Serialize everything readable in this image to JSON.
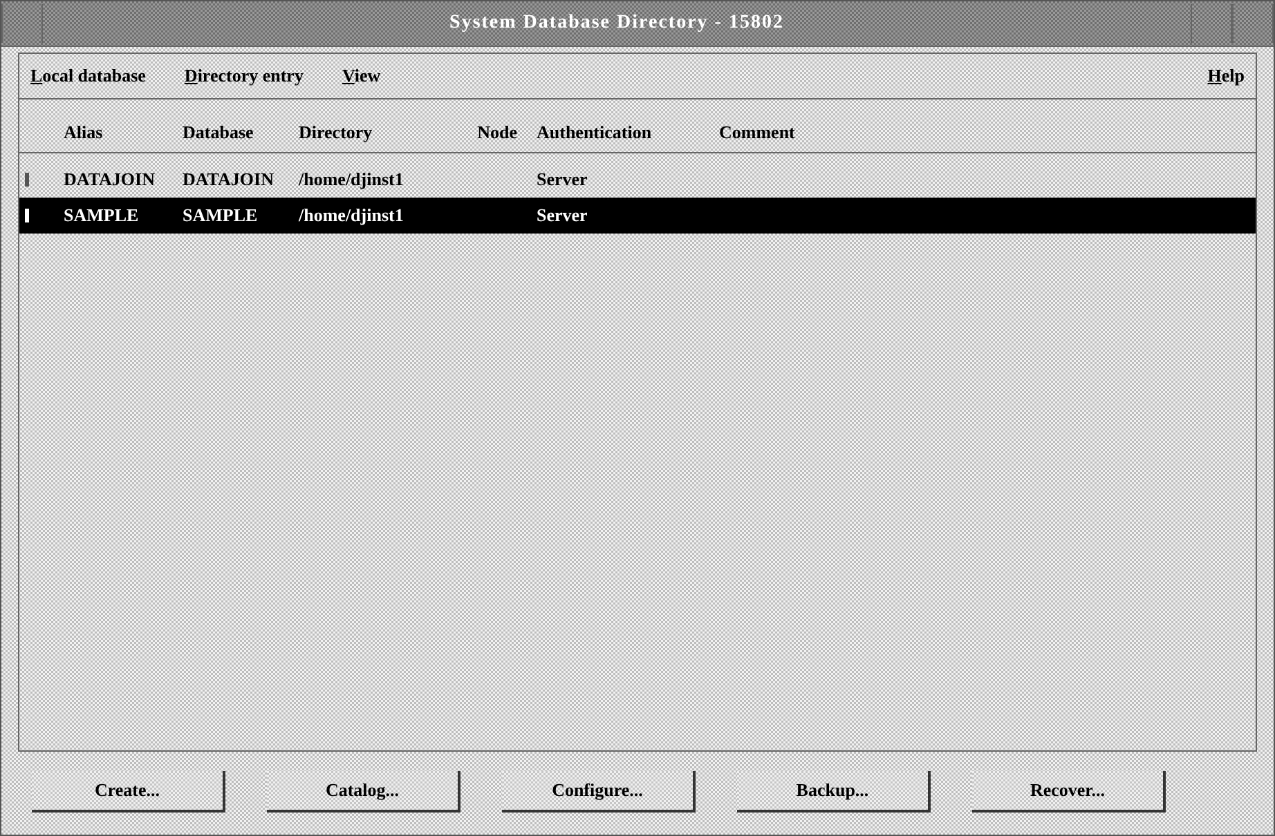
{
  "window": {
    "title": "System Database Directory - 15802"
  },
  "menu": [
    {
      "label": "Local database"
    },
    {
      "label": "Directory entry"
    },
    {
      "label": "View"
    }
  ],
  "help_menu": {
    "label": "Help"
  },
  "table": {
    "columns": [
      "Alias",
      "Database",
      "Directory",
      "Node",
      "Authentication",
      "Comment"
    ],
    "rows": [
      {
        "cells": [
          "DATAJOIN",
          "DATAJOIN",
          "/home/djinst1",
          "",
          "Server",
          ""
        ],
        "selected": false
      },
      {
        "cells": [
          "SAMPLE",
          "SAMPLE",
          "/home/djinst1",
          "",
          "Server",
          ""
        ],
        "selected": true
      }
    ]
  },
  "buttons": [
    "Create...",
    "Catalog...",
    "Configure...",
    "Backup...",
    "Recover..."
  ]
}
